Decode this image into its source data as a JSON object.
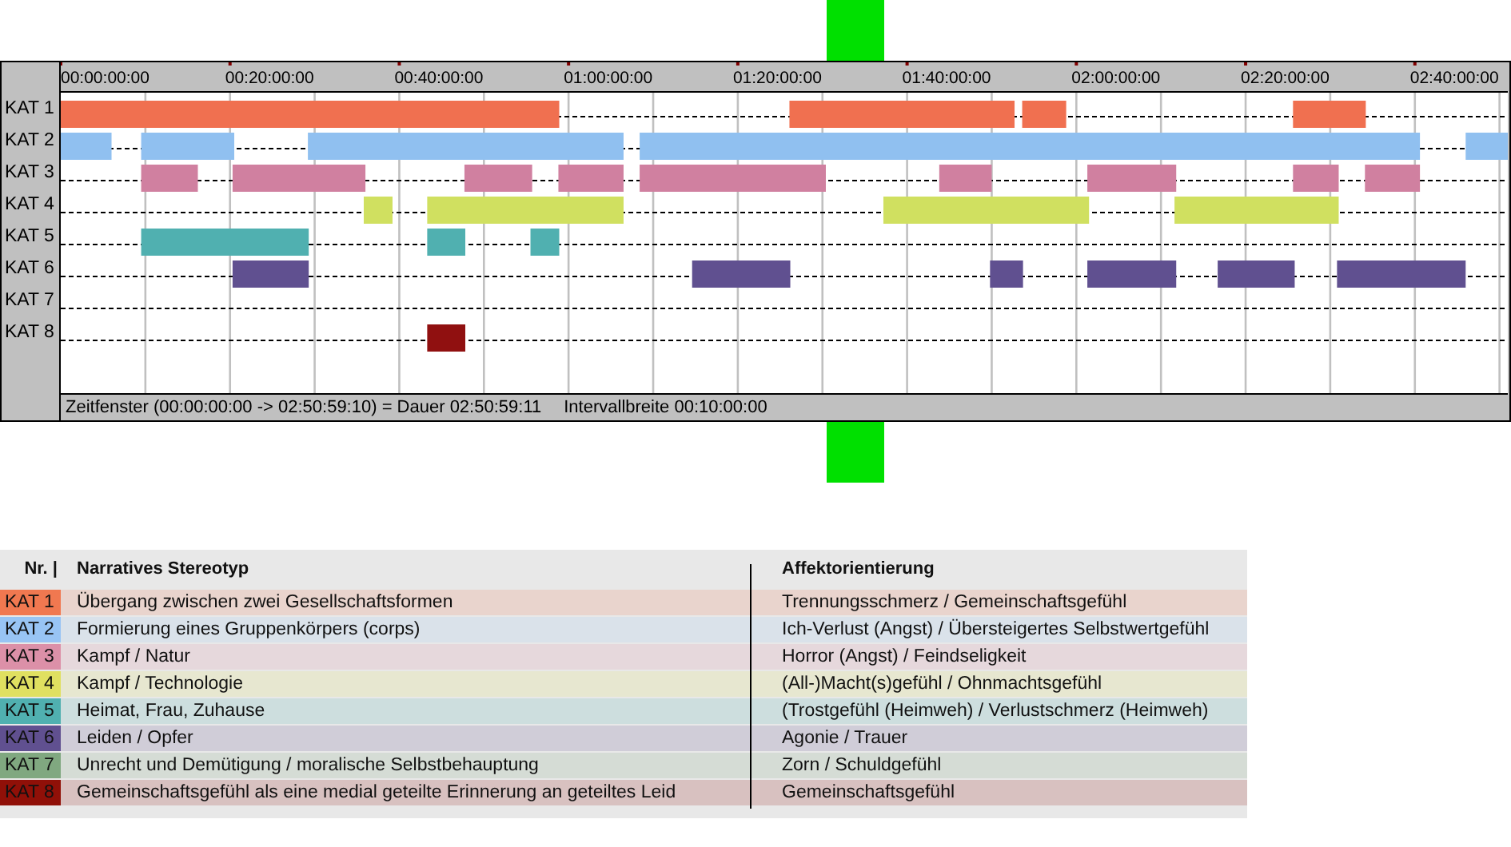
{
  "timeline": {
    "time_labels": [
      "00:00:00:00",
      "00:20:00:00",
      "00:40:00:00",
      "01:00:00:00",
      "01:20:00:00",
      "01:40:00:00",
      "02:00:00:00",
      "02:20:00:00",
      "02:40:00:00"
    ],
    "row_labels": [
      "KAT 1",
      "KAT 2",
      "KAT 3",
      "KAT 4",
      "KAT 5",
      "KAT 6",
      "KAT 7",
      "KAT 8"
    ],
    "status": [
      "Zeitfenster (00:00:00:00 -> 02:50:59:10) = Dauer 02:50:59:11",
      "Intervallbreite 00:10:00:00"
    ]
  },
  "legend": {
    "columns": [
      "Nr. |",
      "Narratives Stereotyp",
      "Affektorientierung"
    ],
    "rows": [
      {
        "nr": "KAT 1",
        "color": "#f07850",
        "stereotype": "Übergang zwischen zwei Gesellschaftsformen",
        "affect": "Trennungsschmerz / Gemeinschaftsgefühl"
      },
      {
        "nr": "KAT 2",
        "color": "#98c4f4",
        "stereotype": "Formierung eines Gruppenkörpers (corps)",
        "affect": "Ich-Verlust (Angst) / Übersteigertes Selbstwertgefühl"
      },
      {
        "nr": "KAT 3",
        "color": "#dc90a8",
        "stereotype": "Kampf / Natur",
        "affect": "Horror (Angst) / Feindseligkeit"
      },
      {
        "nr": "KAT 4",
        "color": "#e0e060",
        "stereotype": "Kampf / Technologie",
        "affect": "(All-)Macht(s)gefühl / Ohnmachtsgefühl"
      },
      {
        "nr": "KAT 5",
        "color": "#50b0b0",
        "stereotype": "Heimat, Frau, Zuhause",
        "affect": "(Trostgefühl (Heimweh) / Verlustschmerz (Heimweh)"
      },
      {
        "nr": "KAT 6",
        "color": "#605090",
        "stereotype": "Leiden / Opfer",
        "affect": "Agonie / Trauer"
      },
      {
        "nr": "KAT 7",
        "color": "#80a880",
        "stereotype": "Unrecht und Demütigung / moralische Selbstbehauptung",
        "affect": "Zorn / Schuldgefühl"
      },
      {
        "nr": "KAT 8",
        "color": "#901008",
        "stereotype": "Gemeinschaftsgefühl als eine medial geteilte Erinnerung an geteiltes Leid",
        "affect": "Gemeinschaftsgefühl"
      }
    ]
  }
}
